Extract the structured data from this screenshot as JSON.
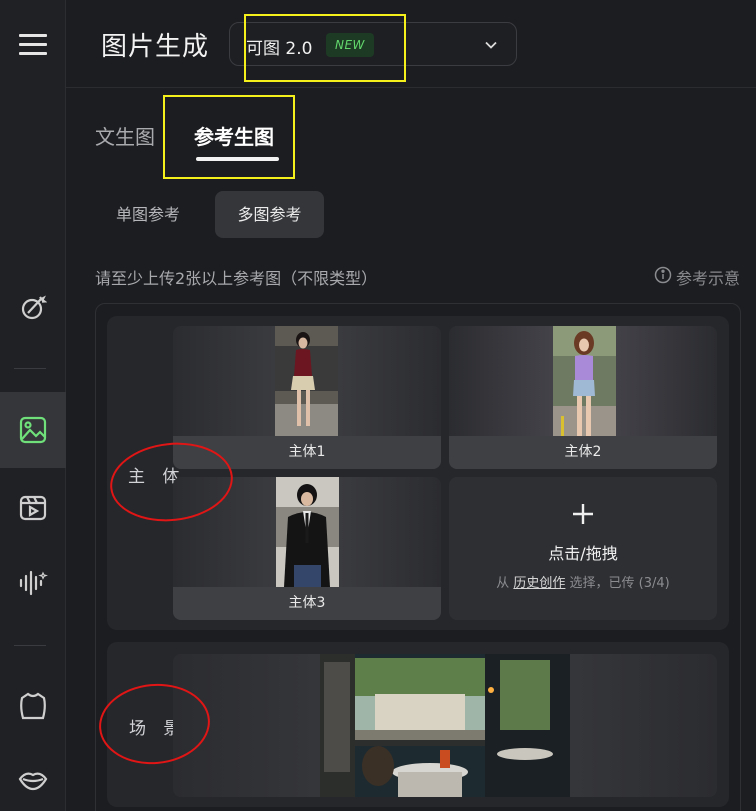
{
  "header": {
    "title": "图片生成",
    "model_name": "可图 2.0",
    "model_badge": "NEW"
  },
  "tabs": [
    {
      "label": "文生图",
      "active": false
    },
    {
      "label": "参考生图",
      "active": true
    }
  ],
  "subtabs": [
    {
      "label": "单图参考",
      "active": false
    },
    {
      "label": "多图参考",
      "active": true
    }
  ],
  "upload": {
    "hint": "请至少上传2张以上参考图（不限类型）",
    "example_link": "参考示意",
    "subject_group_label": "主 体",
    "scene_group_label": "场 景",
    "subjects": [
      {
        "caption": "主体1"
      },
      {
        "caption": "主体2"
      },
      {
        "caption": "主体3"
      }
    ],
    "add_slot": {
      "title": "点击/拖拽",
      "prefix": "从",
      "link": "历史创作",
      "suffix": "选择，已传 (3/4)"
    }
  },
  "colors": {
    "background": "#1c1d20",
    "rail": "#202124",
    "accent_green": "#62d76c",
    "highlight_yellow": "#f5ef1b",
    "annotation_red": "#e01515"
  },
  "icons": [
    "menu-icon",
    "magic-brush-icon",
    "image-icon",
    "video-icon",
    "audio-wave-icon",
    "tshirt-icon",
    "lips-icon",
    "chevron-down-icon",
    "info-icon",
    "plus-icon"
  ]
}
